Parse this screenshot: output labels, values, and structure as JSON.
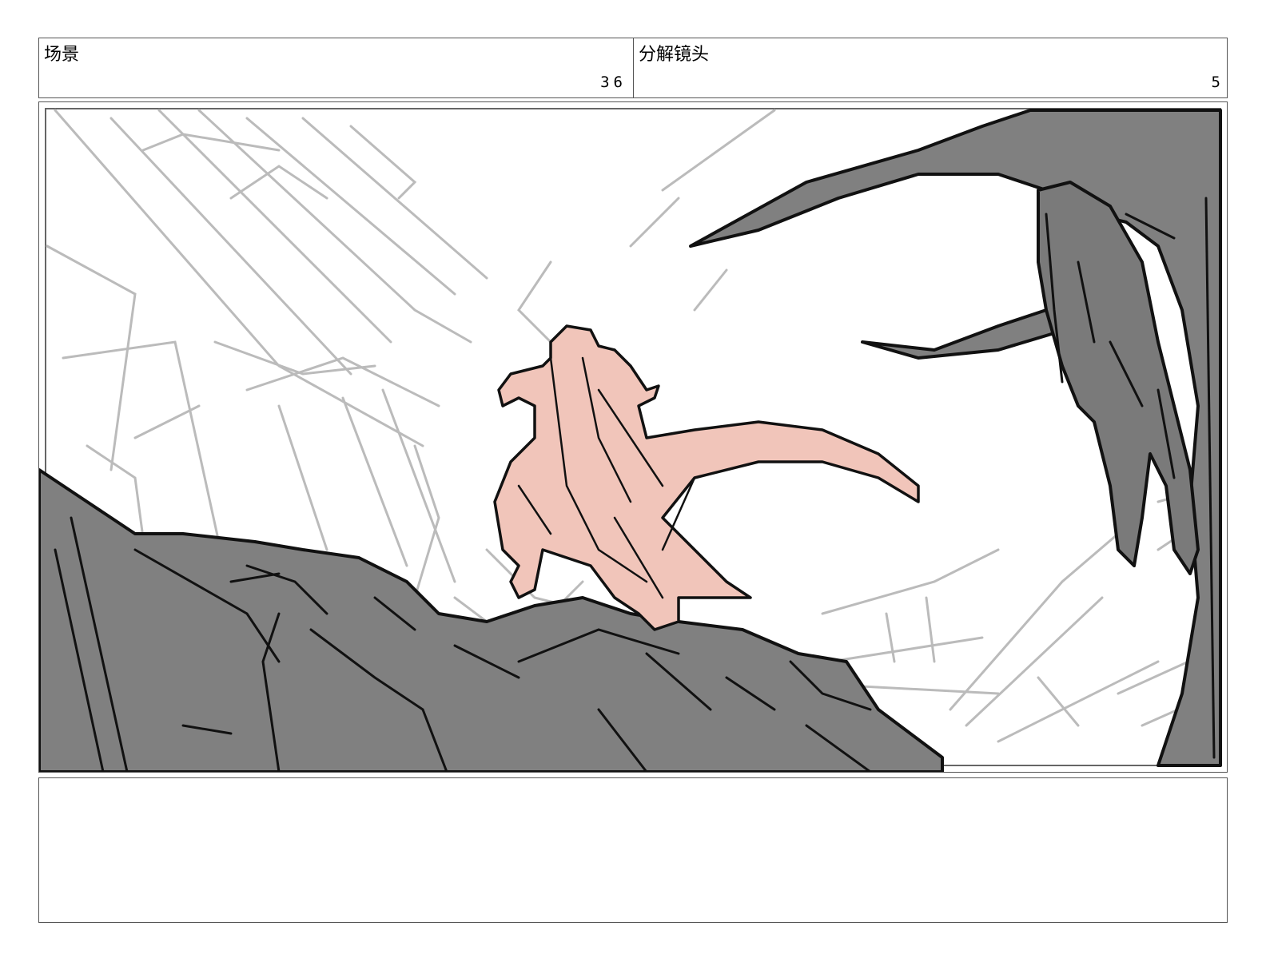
{
  "header": {
    "scene_label": "场景",
    "scene_number": "36",
    "shot_label": "分解镜头",
    "shot_number": "5"
  },
  "notes": {
    "text": ""
  },
  "colors": {
    "silhouette_gray": "#808080",
    "figure_pink": "#f1c5ba",
    "sketch_line_gray": "#bbbbbb",
    "ink_black": "#111111"
  }
}
